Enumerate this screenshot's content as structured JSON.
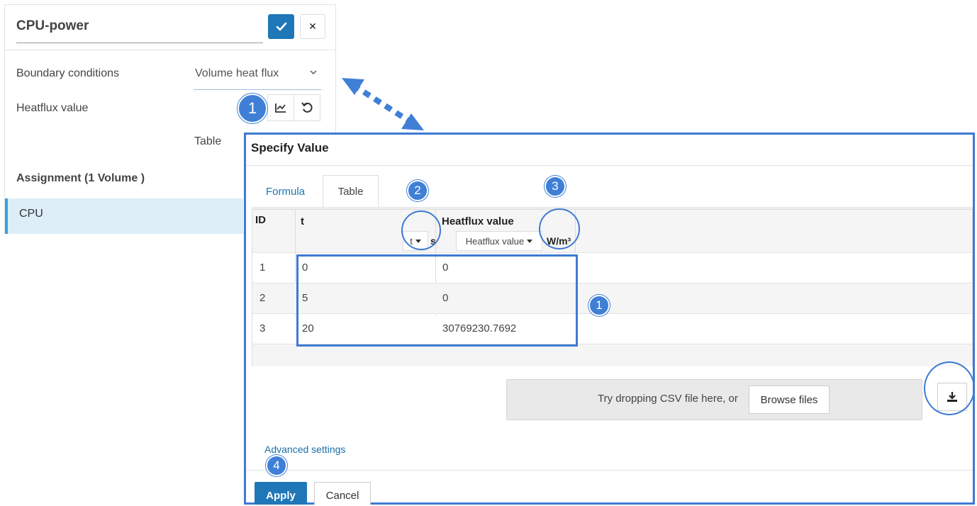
{
  "panel": {
    "title": "CPU-power",
    "confirm_icon": "check-icon",
    "close_icon": "close-icon",
    "boundary_label": "Boundary conditions",
    "boundary_value": "Volume heat flux",
    "heatflux_label": "Heatflux value",
    "heatflux_mode": "Table",
    "assignment_label": "Assignment (1 Volume )",
    "assignment_item": "CPU",
    "accent": "#1f77b8"
  },
  "badges": {
    "b1": "1",
    "b2": "2",
    "b3": "3",
    "b4": "4"
  },
  "dialog": {
    "title": "Specify Value",
    "tabs": [
      "Formula",
      "Table"
    ],
    "columns": {
      "id": "ID",
      "t": "t",
      "t_var": "t",
      "t_unit": "s",
      "heatflux": "Heatflux value",
      "heatflux_var": "Heatflux value",
      "heatflux_unit": "W/m³"
    },
    "rows": [
      {
        "id": "1",
        "t": "0",
        "v": "0"
      },
      {
        "id": "2",
        "t": "5",
        "v": "0"
      },
      {
        "id": "3",
        "t": "20",
        "v": "30769230.7692"
      }
    ],
    "dropzone_text": "Try dropping CSV file here, or",
    "browse_label": "Browse files",
    "advanced": "Advanced settings",
    "apply": "Apply",
    "cancel": "Cancel",
    "highlight_color": "#3e7ad3"
  }
}
